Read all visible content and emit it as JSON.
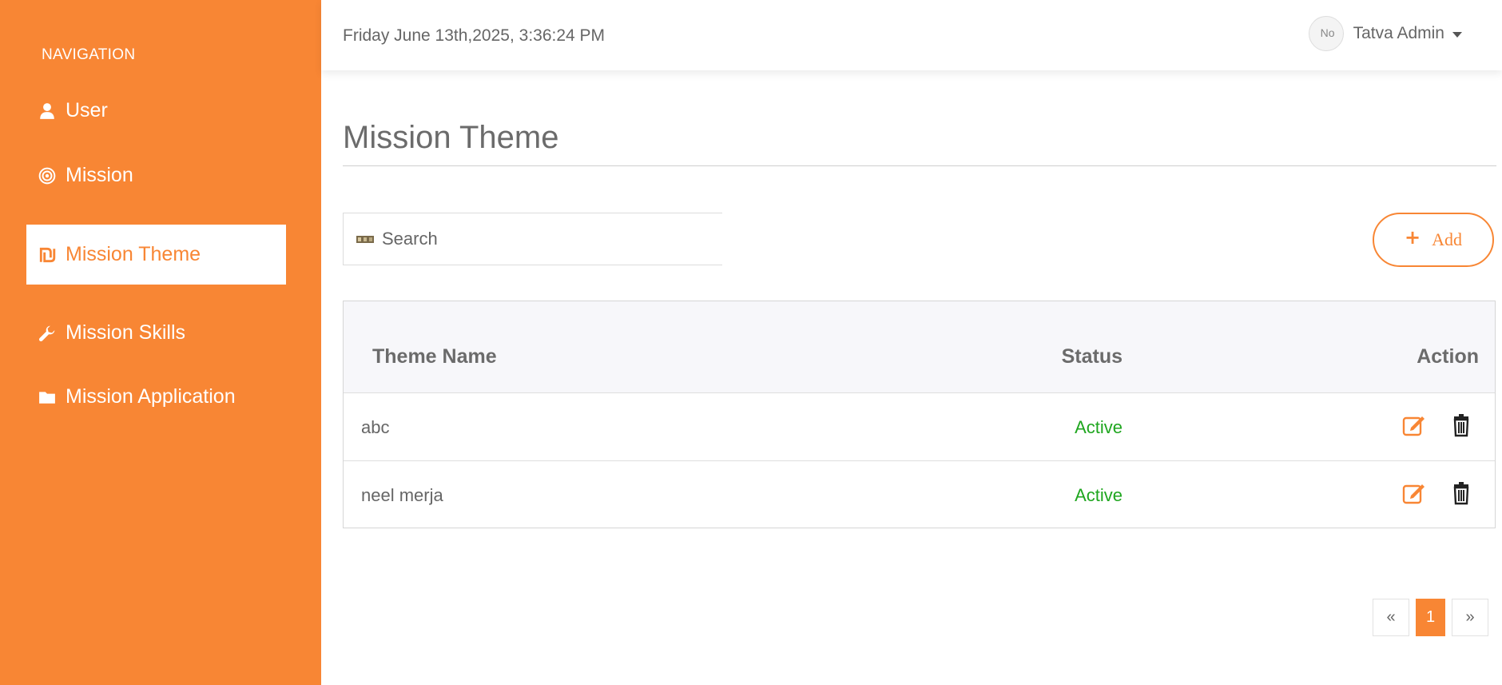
{
  "sidebar": {
    "heading": "NAVIGATION",
    "items": [
      {
        "label": "User",
        "icon": "user-icon"
      },
      {
        "label": "Mission",
        "icon": "target-icon"
      },
      {
        "label": "Mission Theme",
        "icon": "theme-icon",
        "active": true
      },
      {
        "label": "Mission Skills",
        "icon": "wrench-icon"
      },
      {
        "label": "Mission Application",
        "icon": "folder-icon"
      }
    ]
  },
  "header": {
    "datetime": "Friday June 13th,2025, 3:36:24 PM",
    "avatar_alt": "No",
    "user_name": "Tatva Admin"
  },
  "main": {
    "title": "Mission Theme",
    "search_placeholder": "Search",
    "add_label": "Add",
    "table": {
      "columns": [
        "Theme Name",
        "Status",
        "Action"
      ],
      "rows": [
        {
          "name": "abc",
          "status": "Active"
        },
        {
          "name": "neel merja",
          "status": "Active"
        }
      ]
    },
    "pagination": {
      "prev": "«",
      "current": "1",
      "next": "»"
    }
  },
  "colors": {
    "accent": "#f88634",
    "status_active": "#1fa61f"
  }
}
